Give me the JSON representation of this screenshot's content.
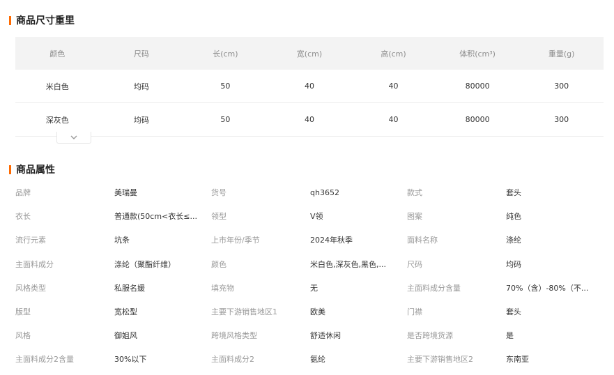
{
  "size_section": {
    "title": "商品尺寸重里",
    "headers": [
      "颜色",
      "尺码",
      "长(cm)",
      "宽(cm)",
      "高(cm)",
      "体积(cm³)",
      "重量(g)"
    ],
    "rows": [
      [
        "米白色",
        "均码",
        "50",
        "40",
        "40",
        "80000",
        "300"
      ],
      [
        "深灰色",
        "均码",
        "50",
        "40",
        "40",
        "80000",
        "300"
      ]
    ],
    "expand_icon": "chevron-down-icon"
  },
  "attr_section": {
    "title": "商品属性",
    "rows": [
      [
        {
          "k": "品牌",
          "v": "美瑞曼"
        },
        {
          "k": "货号",
          "v": "qh3652"
        },
        {
          "k": "款式",
          "v": "套头"
        }
      ],
      [
        {
          "k": "衣长",
          "v": "普通款(50cm<衣长≤..."
        },
        {
          "k": "领型",
          "v": "V领"
        },
        {
          "k": "图案",
          "v": "纯色"
        }
      ],
      [
        {
          "k": "流行元素",
          "v": "坑条"
        },
        {
          "k": "上市年份/季节",
          "v": "2024年秋季"
        },
        {
          "k": "面料名称",
          "v": "涤纶"
        }
      ],
      [
        {
          "k": "主面料成分",
          "v": "涤纶（聚酯纤维）"
        },
        {
          "k": "颜色",
          "v": "米白色,深灰色,黑色,..."
        },
        {
          "k": "尺码",
          "v": "均码"
        }
      ],
      [
        {
          "k": "风格类型",
          "v": "私服名媛"
        },
        {
          "k": "填充物",
          "v": "无"
        },
        {
          "k": "主面料成分含量",
          "v": "70%（含）-80%（不..."
        }
      ],
      [
        {
          "k": "版型",
          "v": "宽松型"
        },
        {
          "k": "主要下游销售地区1",
          "v": "欧美"
        },
        {
          "k": "门襟",
          "v": "套头"
        }
      ],
      [
        {
          "k": "风格",
          "v": "御姐风"
        },
        {
          "k": "跨境风格类型",
          "v": "舒适休闲"
        },
        {
          "k": "是否跨境货源",
          "v": "是"
        }
      ],
      [
        {
          "k": "主面料成分2含量",
          "v": "30%以下"
        },
        {
          "k": "主面料成分2",
          "v": "氨纶"
        },
        {
          "k": "主要下游销售地区2",
          "v": "东南亚"
        }
      ]
    ]
  },
  "colors": {
    "accent": "#ff6a00",
    "header_bg": "#f3f3f3"
  }
}
